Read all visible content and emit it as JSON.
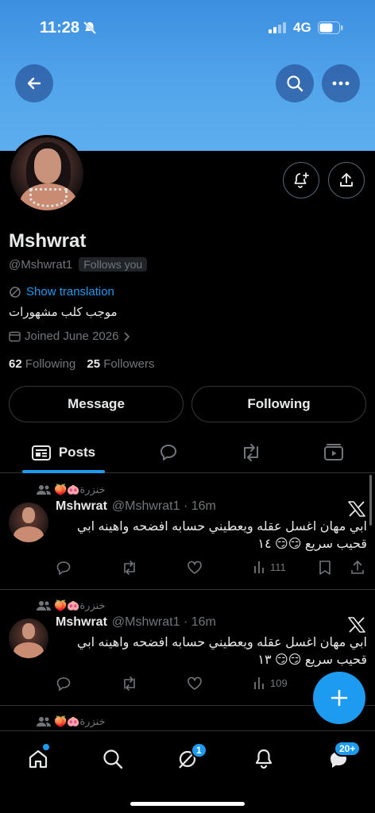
{
  "status_bar": {
    "time": "11:28",
    "network": "4G"
  },
  "profile": {
    "name": "Mshwrat",
    "handle": "@Mshwrat1",
    "follows_you": "Follows you",
    "show_translation": "Show translation",
    "bio": "موجب كلب مشهورات",
    "joined": "Joined June 2026",
    "following_count": "62",
    "following_label": "Following",
    "followers_count": "25",
    "followers_label": "Followers"
  },
  "actions": {
    "message": "Message",
    "following": "Following"
  },
  "tabs": {
    "posts": "Posts"
  },
  "posts": [
    {
      "reposted_by": "خنزرة",
      "reposted_emoji": "🍑🐽",
      "name": "Mshwrat",
      "handle_time": "@Mshwrat1 · 16m",
      "text": "ابي مهان اغسل عقله ويعطيني حسابه افضحه واهينه ابي قحيب سريع 😏😏 ١٤",
      "views": "111"
    },
    {
      "reposted_by": "خنزرة",
      "reposted_emoji": "🍑🐽",
      "name": "Mshwrat",
      "handle_time": "@Mshwrat1 · 16m",
      "text": "ابي مهان اغسل عقله ويعطيني حسابه افضحه واهينه ابي قحيب سريع 😏😏 ١٣",
      "views": "109"
    },
    {
      "reposted_by": "خنزرة",
      "reposted_emoji": "🍑🐽"
    }
  ],
  "nav": {
    "chat_badge": "1",
    "messages_badge": "20+"
  },
  "colors": {
    "accent": "#1d9bf0",
    "banner": "#4fa3ea",
    "background": "#000000"
  }
}
